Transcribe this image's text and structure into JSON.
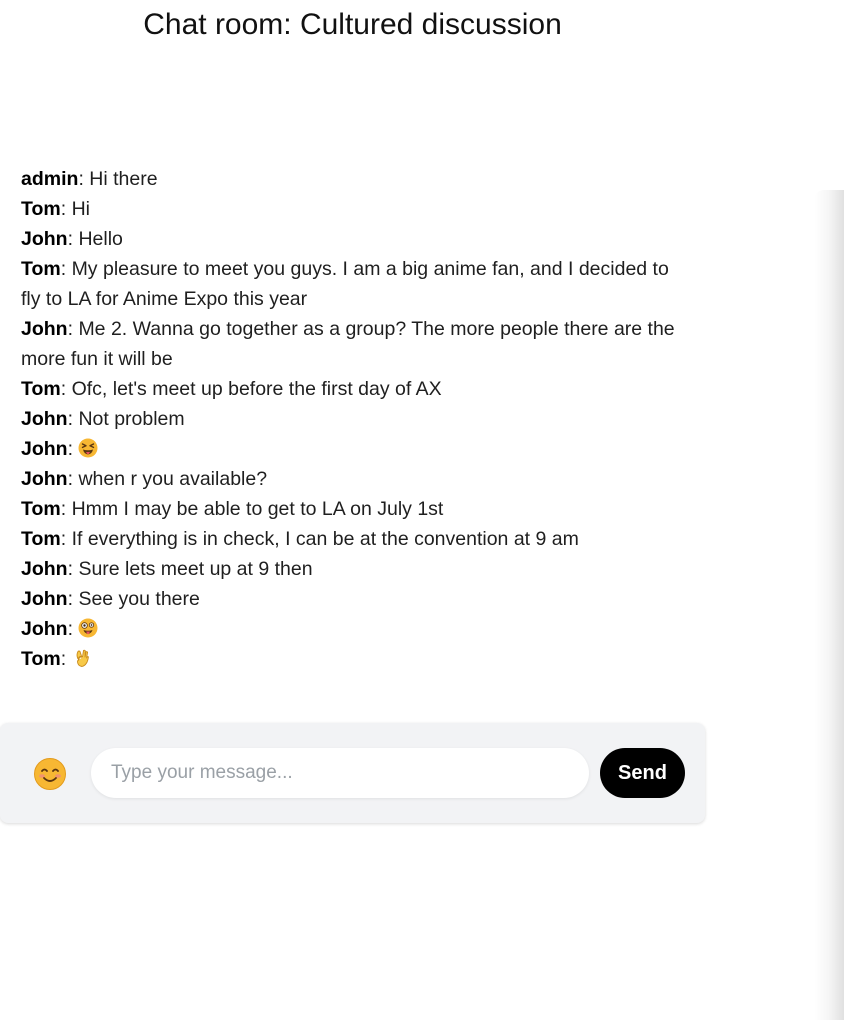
{
  "title": "Chat room: Cultured discussion",
  "messages": [
    {
      "sender": "admin",
      "text": "Hi there"
    },
    {
      "sender": "Tom",
      "text": "Hi"
    },
    {
      "sender": "John",
      "text": "Hello"
    },
    {
      "sender": "Tom",
      "text": "My pleasure to meet you guys. I am a big anime fan, and I decided to fly to LA for Anime Expo this year"
    },
    {
      "sender": "John",
      "text": "Me 2. Wanna go together as a group? The more people there are the more fun it will be"
    },
    {
      "sender": "Tom",
      "text": "Ofc, let's meet up before the first day of AX"
    },
    {
      "sender": "John",
      "text": "Not problem"
    },
    {
      "sender": "John",
      "emoji": "squinting-face-with-tongue-icon"
    },
    {
      "sender": "John",
      "text": "when r you available?"
    },
    {
      "sender": "Tom",
      "text": "Hmm I may be able to get to LA on July 1st"
    },
    {
      "sender": "Tom",
      "text": "If everything is in check, I can be at the convention at 9 am"
    },
    {
      "sender": "John",
      "text": "Sure lets meet up at 9 then"
    },
    {
      "sender": "John",
      "text": "See you there"
    },
    {
      "sender": "John",
      "emoji": "zany-face-icon"
    },
    {
      "sender": "Tom",
      "emoji": "ok-hand-icon"
    }
  ],
  "separator": ": ",
  "composer": {
    "emoji_button_icon": "smiling-face-icon",
    "placeholder": "Type your message...",
    "value": "",
    "send_label": "Send"
  },
  "colors": {
    "send_button": "#000000",
    "composer_background": "#f2f3f5",
    "emoji_yellow": "#f7b733"
  }
}
